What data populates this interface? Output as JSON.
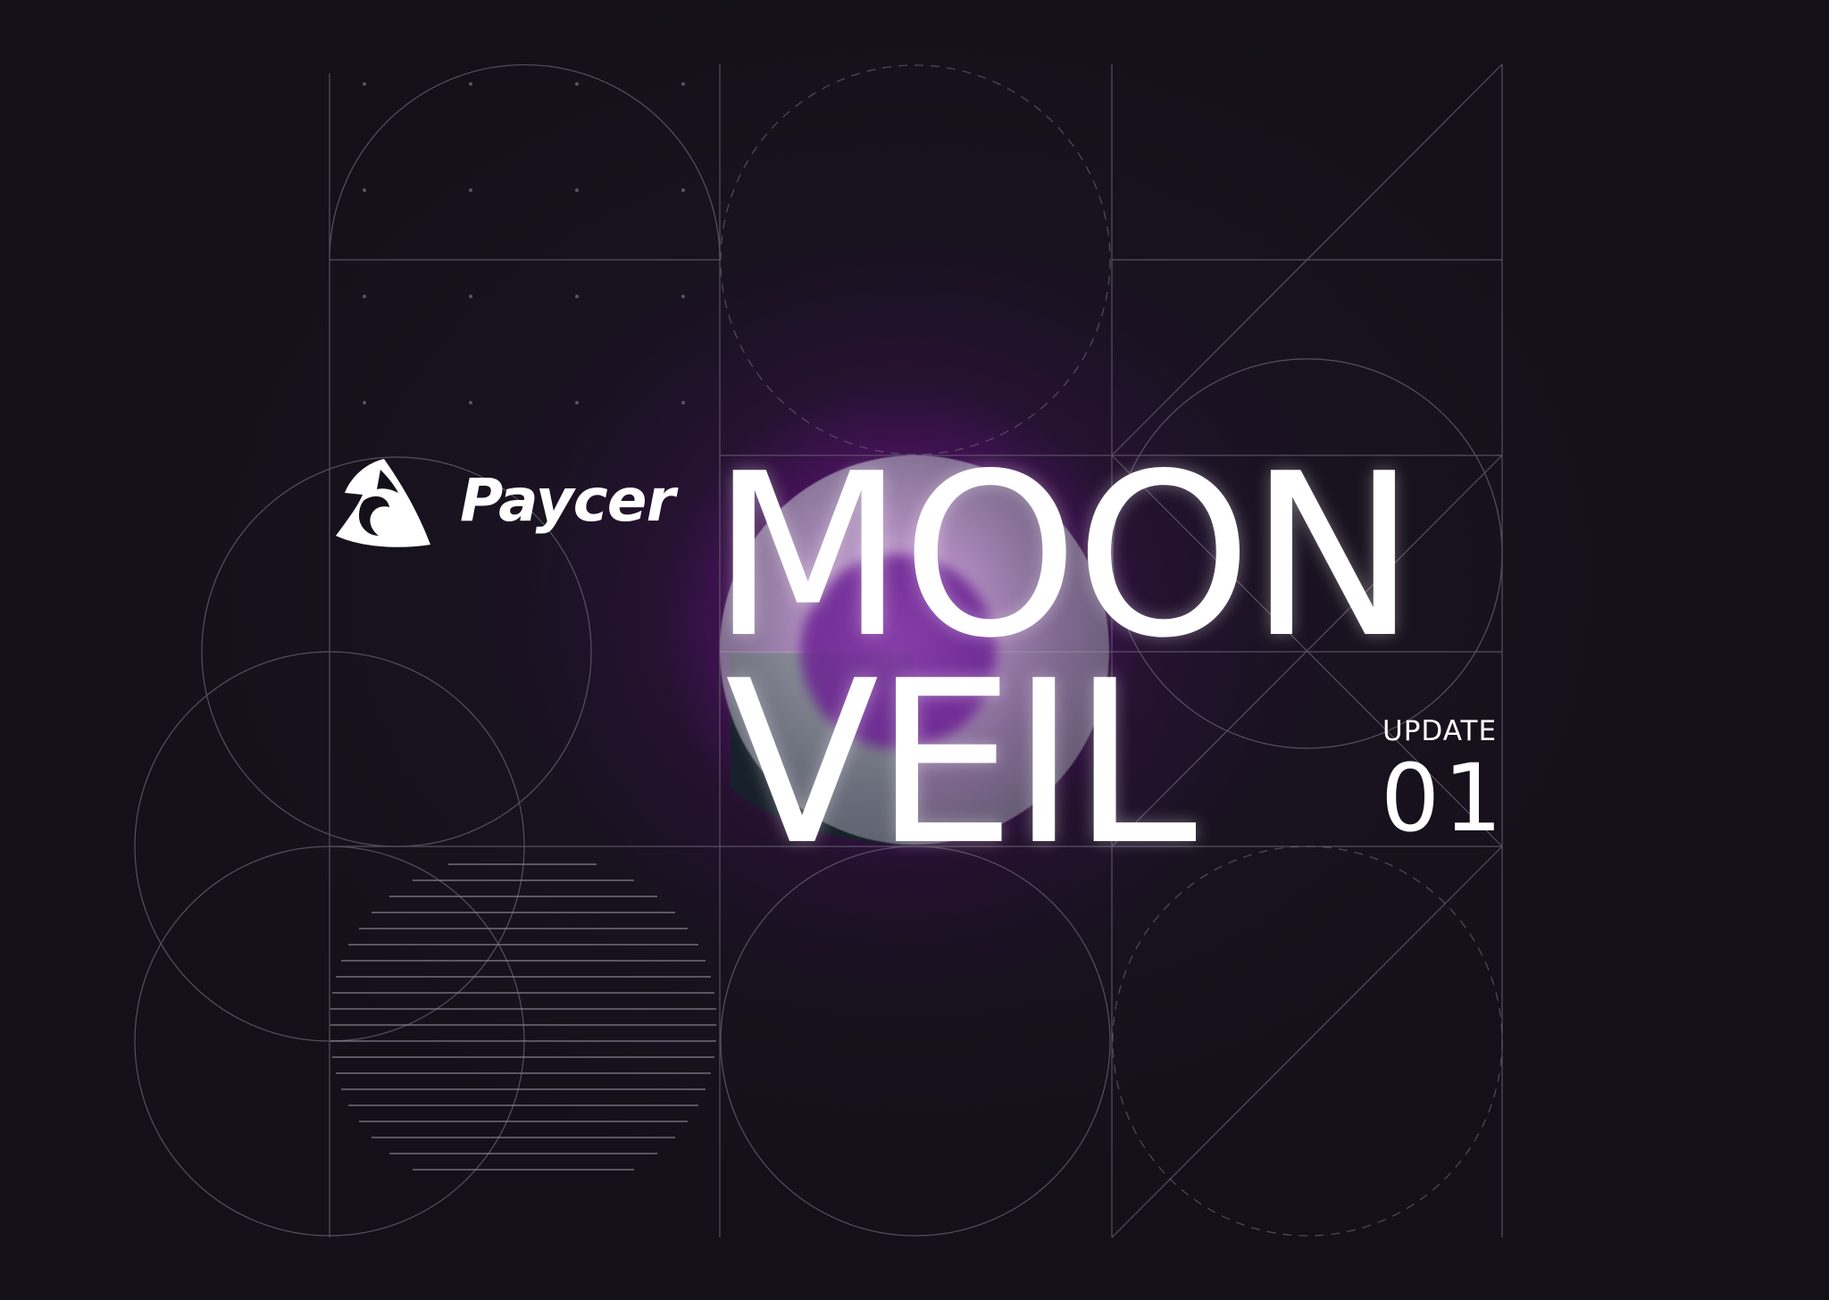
{
  "brand": {
    "name": "Paycer",
    "logo_icon": "horse-head-shield-icon"
  },
  "title": {
    "line1": "MOON",
    "line2": "VEIL"
  },
  "update": {
    "label": "UPDATE",
    "number": "01"
  },
  "colors": {
    "background": "#141019",
    "glow": "#b014c8",
    "text": "#ffffff",
    "grid_lines": "#6b6475"
  }
}
